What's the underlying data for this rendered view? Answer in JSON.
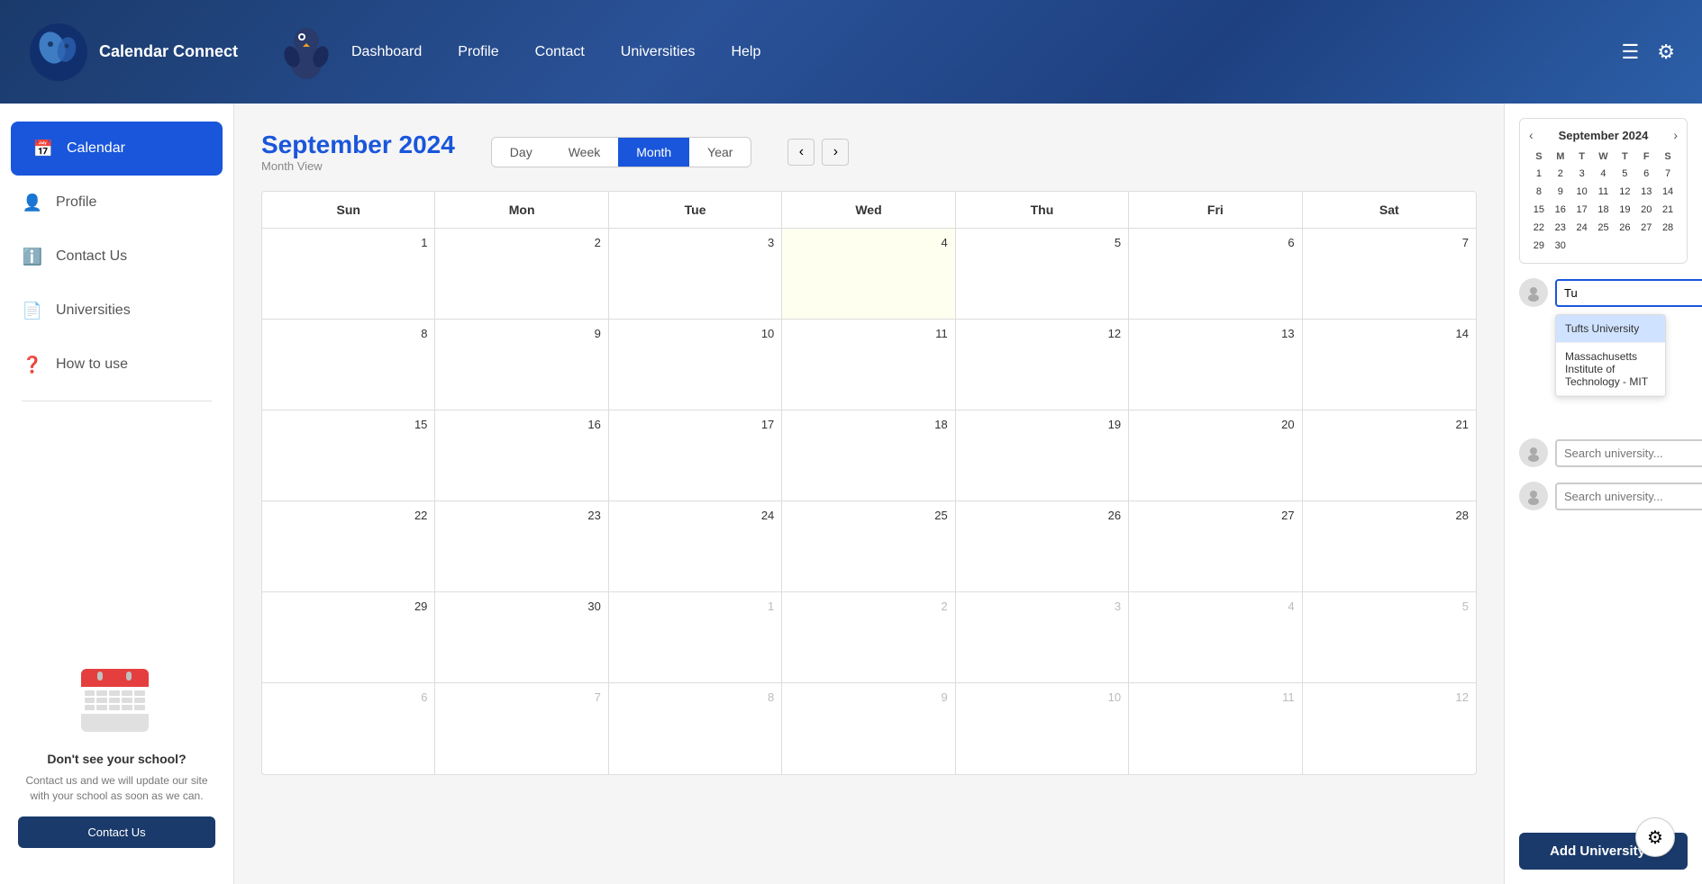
{
  "app": {
    "name": "Calendar Connect"
  },
  "topnav": {
    "links": [
      {
        "label": "Dashboard",
        "id": "dashboard"
      },
      {
        "label": "Profile",
        "id": "profile"
      },
      {
        "label": "Contact",
        "id": "contact"
      },
      {
        "label": "Universities",
        "id": "universities"
      },
      {
        "label": "Help",
        "id": "help"
      }
    ]
  },
  "sidebar": {
    "items": [
      {
        "label": "Calendar",
        "id": "calendar",
        "icon": "📅",
        "active": true
      },
      {
        "label": "Profile",
        "id": "profile",
        "icon": "👤",
        "active": false
      },
      {
        "label": "Contact Us",
        "id": "contact",
        "icon": "ℹ️",
        "active": false
      },
      {
        "label": "Universities",
        "id": "universities",
        "icon": "📄",
        "active": false
      },
      {
        "label": "How to use",
        "id": "howto",
        "icon": "❓",
        "active": false
      }
    ],
    "bottom": {
      "title": "Don't see your school?",
      "text": "Contact us and we will update our site with your school as soon as we can.",
      "cta": "Contact Us"
    }
  },
  "calendar": {
    "title": "September 2024",
    "subtitle": "Month View",
    "views": [
      "Day",
      "Week",
      "Month",
      "Year"
    ],
    "active_view": "Month",
    "days_header": [
      "Sun",
      "Mon",
      "Tue",
      "Wed",
      "Thu",
      "Fri",
      "Sat"
    ],
    "weeks": [
      [
        {
          "day": "1",
          "other": false,
          "today": false
        },
        {
          "day": "2",
          "other": false,
          "today": false
        },
        {
          "day": "3",
          "other": false,
          "today": false
        },
        {
          "day": "4",
          "other": false,
          "today": true
        },
        {
          "day": "5",
          "other": false,
          "today": false
        },
        {
          "day": "6",
          "other": false,
          "today": false
        },
        {
          "day": "7",
          "other": false,
          "today": false
        }
      ],
      [
        {
          "day": "8",
          "other": false,
          "today": false
        },
        {
          "day": "9",
          "other": false,
          "today": false
        },
        {
          "day": "10",
          "other": false,
          "today": false
        },
        {
          "day": "11",
          "other": false,
          "today": false
        },
        {
          "day": "12",
          "other": false,
          "today": false
        },
        {
          "day": "13",
          "other": false,
          "today": false
        },
        {
          "day": "14",
          "other": false,
          "today": false
        }
      ],
      [
        {
          "day": "15",
          "other": false,
          "today": false
        },
        {
          "day": "16",
          "other": false,
          "today": false
        },
        {
          "day": "17",
          "other": false,
          "today": false
        },
        {
          "day": "18",
          "other": false,
          "today": false
        },
        {
          "day": "19",
          "other": false,
          "today": false
        },
        {
          "day": "20",
          "other": false,
          "today": false
        },
        {
          "day": "21",
          "other": false,
          "today": false
        }
      ],
      [
        {
          "day": "22",
          "other": false,
          "today": false
        },
        {
          "day": "23",
          "other": false,
          "today": false
        },
        {
          "day": "24",
          "other": false,
          "today": false
        },
        {
          "day": "25",
          "other": false,
          "today": false
        },
        {
          "day": "26",
          "other": false,
          "today": false
        },
        {
          "day": "27",
          "other": false,
          "today": false
        },
        {
          "day": "28",
          "other": false,
          "today": false
        }
      ],
      [
        {
          "day": "29",
          "other": false,
          "today": false
        },
        {
          "day": "30",
          "other": false,
          "today": false
        },
        {
          "day": "1",
          "other": true,
          "today": false
        },
        {
          "day": "2",
          "other": true,
          "today": false
        },
        {
          "day": "3",
          "other": true,
          "today": false
        },
        {
          "day": "4",
          "other": true,
          "today": false
        },
        {
          "day": "5",
          "other": true,
          "today": false
        }
      ],
      [
        {
          "day": "6",
          "other": true,
          "today": false
        },
        {
          "day": "7",
          "other": true,
          "today": false
        },
        {
          "day": "8",
          "other": true,
          "today": false
        },
        {
          "day": "9",
          "other": true,
          "today": false
        },
        {
          "day": "10",
          "other": true,
          "today": false
        },
        {
          "day": "11",
          "other": true,
          "today": false
        },
        {
          "day": "12",
          "other": true,
          "today": false
        }
      ]
    ]
  },
  "mini_calendar": {
    "title": "September 2024",
    "days_header": [
      "S",
      "M",
      "T",
      "W",
      "T",
      "F",
      "S"
    ],
    "days": [
      "1",
      "2",
      "3",
      "4",
      "5",
      "6",
      "7",
      "8",
      "9",
      "10",
      "11",
      "12",
      "13",
      "14",
      "15",
      "16",
      "17",
      "18",
      "19",
      "20",
      "21",
      "22",
      "23",
      "24",
      "25",
      "26",
      "27",
      "28",
      "29",
      "30"
    ]
  },
  "right_panel": {
    "universities": [
      {
        "id": 1,
        "search_value": "Tu",
        "placeholder": "Search university..."
      },
      {
        "id": 2,
        "search_value": "",
        "placeholder": "Search university..."
      },
      {
        "id": 3,
        "search_value": "",
        "placeholder": "Search university..."
      }
    ],
    "dropdown": {
      "visible": true,
      "items": [
        {
          "label": "Tufts University",
          "selected": true
        },
        {
          "label": "Massachusetts Institute of Technology - MIT",
          "selected": false
        }
      ]
    },
    "add_button_label": "Add University +"
  }
}
